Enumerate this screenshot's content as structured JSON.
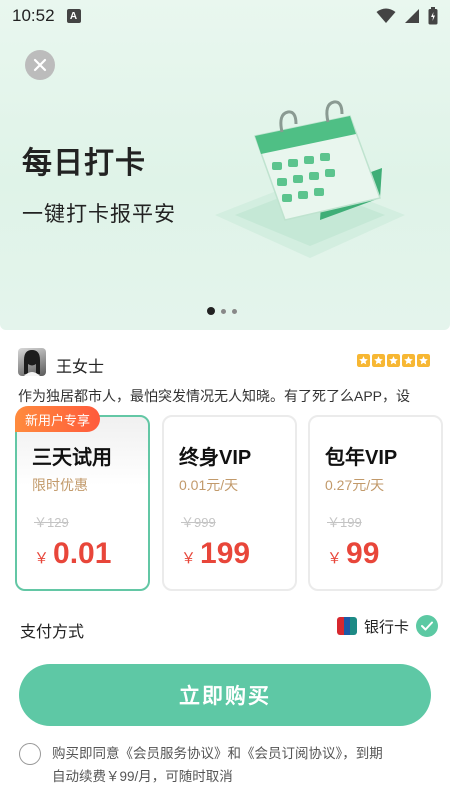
{
  "status": {
    "time": "10:52",
    "notification_glyph": "A"
  },
  "hero": {
    "title": "每日打卡",
    "subtitle": "一键打卡报平安",
    "illustration_icon": "calendar-icon",
    "carousel_pages": 3,
    "carousel_active": 1
  },
  "review": {
    "name": "王女士",
    "rating": 5,
    "text": "作为独居都市人，最怕突发情况无人知晓。有了死了么APP，设"
  },
  "plans": [
    {
      "badge": "新用户专享",
      "name": "三天试用",
      "desc": "限时优惠",
      "original": "￥129",
      "currency": "￥",
      "price": "0.01",
      "selected": true
    },
    {
      "badge": "",
      "name": "终身VIP",
      "desc": "0.01元/天",
      "original": "￥999",
      "currency": "￥",
      "price": "199",
      "selected": false
    },
    {
      "badge": "",
      "name": "包年VIP",
      "desc": "0.27元/天",
      "original": "￥199",
      "currency": "￥",
      "price": "99",
      "selected": false
    }
  ],
  "payment": {
    "label": "支付方式",
    "method": "银行卡",
    "method_icon": "unionpay-icon"
  },
  "cta": {
    "label": "立即购买"
  },
  "agreement": {
    "text_line1": "购买即同意《会员服务协议》和《会员订阅协议》，到期",
    "text_line2": "自动续费￥99/月，可随时取消"
  },
  "colors": {
    "accent": "#5ec8a5",
    "price": "#e8463a",
    "desc": "#c29a6b",
    "badge": "#ff6a3c"
  }
}
